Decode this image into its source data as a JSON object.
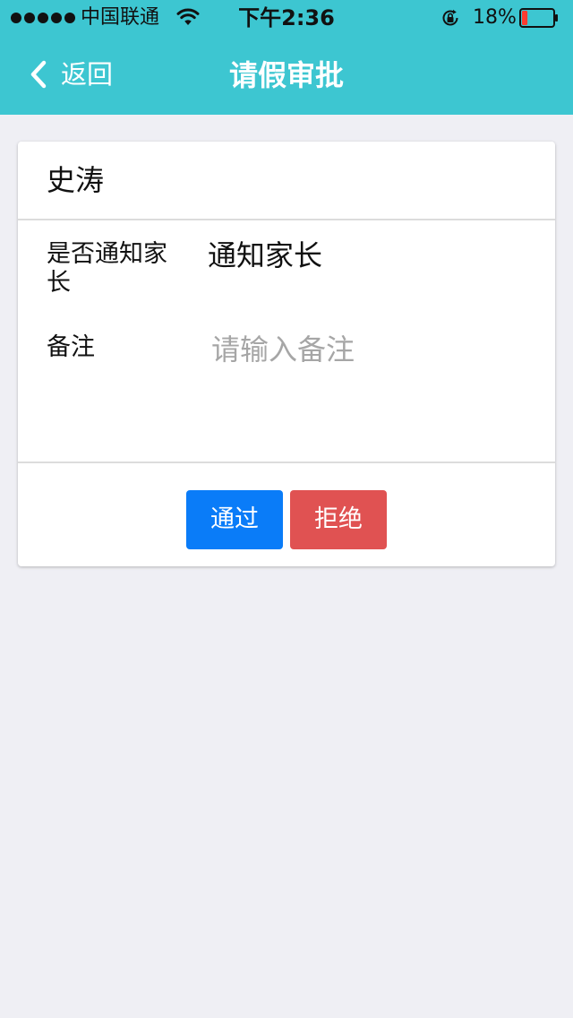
{
  "status_bar": {
    "carrier": "中国联通",
    "time": "下午2:36",
    "battery_percent": "18%",
    "battery_level": 0.18,
    "signal_bars": 5,
    "icons": [
      "signal-dots-icon",
      "wifi-icon",
      "rotation-lock-icon",
      "battery-icon"
    ]
  },
  "nav": {
    "back_label": "返回",
    "title": "请假审批",
    "back_icon": "chevron-left-icon"
  },
  "card": {
    "name": "史涛",
    "notify_label": "是否通知家长",
    "notify_value": "通知家长",
    "remark_label": "备注",
    "remark_value": "",
    "remark_placeholder": "请输入备注"
  },
  "actions": {
    "approve_label": "通过",
    "reject_label": "拒绝"
  },
  "colors": {
    "header_bg": "#3dc6d1",
    "page_bg": "#efeff4",
    "approve": "#0a7cf8",
    "reject": "#e05252",
    "battery_low": "#ff3b30"
  }
}
